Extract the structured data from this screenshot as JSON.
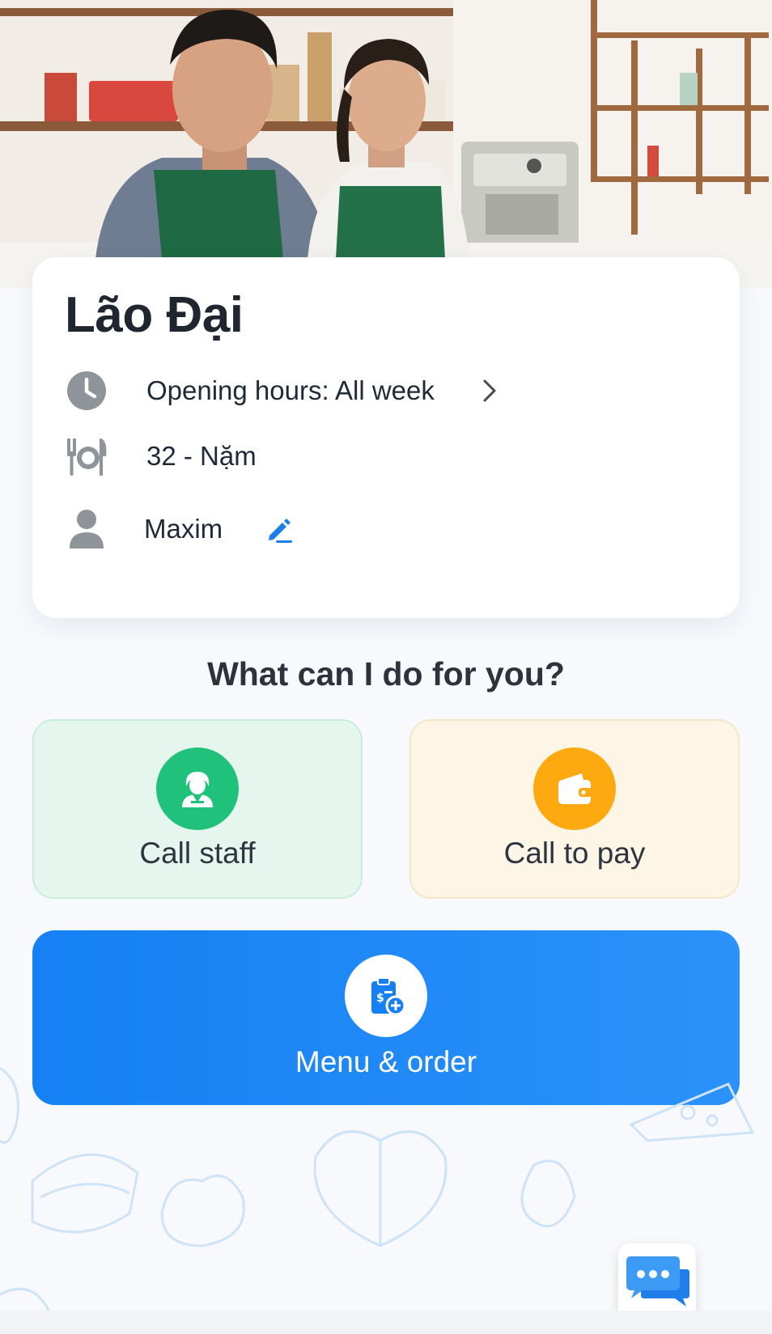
{
  "restaurant": {
    "name": "Lão Đại",
    "opening_hours": "Opening hours: All week",
    "table": "32 - Nặm",
    "customer_name": "Maxim"
  },
  "prompt": "What can I do for you?",
  "actions": {
    "call_staff": "Call staff",
    "call_to_pay": "Call to pay",
    "menu_order": "Menu & order"
  },
  "icons": {
    "hours": "clock-icon",
    "table": "table-dining-icon",
    "user": "user-icon",
    "edit": "pencil-icon",
    "chevron": "chevron-right-icon",
    "staff": "waitress-icon",
    "pay": "wallet-icon",
    "menu": "clipboard-order-icon",
    "chat": "chat-bubbles-icon"
  },
  "colors": {
    "accent_blue": "#1580f4",
    "staff_green": "#20c17a",
    "pay_orange": "#fda90f"
  }
}
